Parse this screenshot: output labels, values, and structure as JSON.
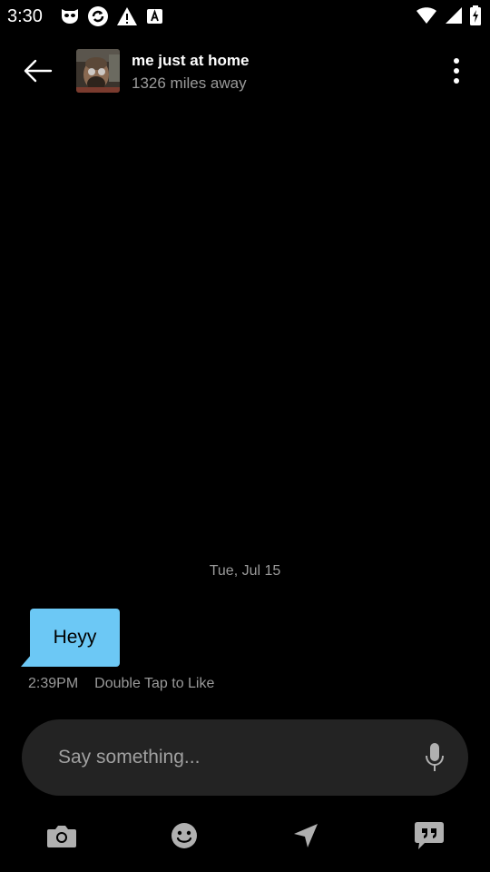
{
  "status_bar": {
    "time": "3:30",
    "icons_left": [
      "mask-icon",
      "sync-icon",
      "warning-icon",
      "a-icon"
    ],
    "icons_right": [
      "wifi-icon",
      "signal-icon",
      "battery-icon"
    ]
  },
  "header": {
    "back_icon": "back-arrow-icon",
    "profile_name": "me just at home",
    "distance": "1326 miles away",
    "more_icon": "more-vertical-icon"
  },
  "conversation": {
    "date": "Tue, Jul 15",
    "messages": [
      {
        "text": "Heyy",
        "time": "2:39PM",
        "hint": "Double Tap to Like",
        "bubble_color": "#6cc8f5"
      }
    ]
  },
  "composer": {
    "placeholder": "Say something...",
    "mic_icon": "microphone-icon"
  },
  "toolbar": {
    "items": [
      "camera-icon",
      "emoji-icon",
      "location-icon",
      "quick-reply-icon"
    ]
  },
  "colors": {
    "background": "#000000",
    "accent": "#6cc8f5",
    "composer": "#232323",
    "muted_text": "#9a9a9a",
    "icon_gray": "#b0b0b0"
  }
}
